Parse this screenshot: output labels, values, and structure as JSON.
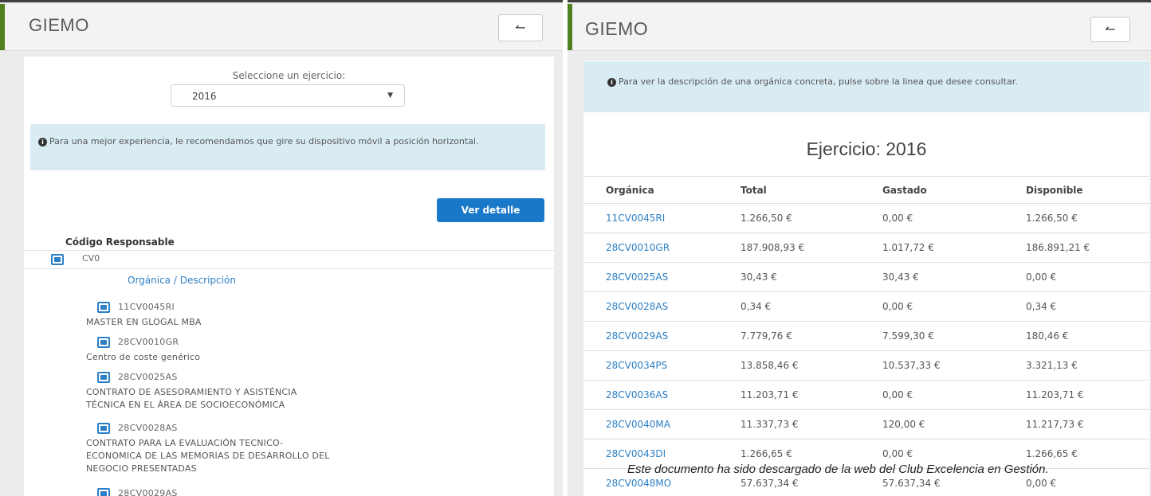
{
  "left": {
    "app_title": "GIEMO",
    "back_button": "↼",
    "select_label": "Seleccione un ejercicio:",
    "selected_year": "2016",
    "info_message": "Para una mejor experiencia, le recomendamos que gire su dispositivo móvil a posición horizontal.",
    "detail_button": "Ver detalle",
    "codigo_label": "Código Responsable",
    "responsible_code": "CV0",
    "organica_header": "Orgánica / Descripción",
    "tree": [
      {
        "code": "11CV0045RI",
        "desc": [
          "MASTER EN GLOGAL MBA"
        ]
      },
      {
        "code": "28CV0010GR",
        "desc": [
          "Centro de coste genérico"
        ]
      },
      {
        "code": "28CV0025AS",
        "desc": [
          "CONTRATO DE ASESORAMIENTO Y ASISTÉNCIA",
          "TÉCNICA EN EL ÁREA DE SOCIOECONÓMICA"
        ]
      },
      {
        "code": "28CV0028AS",
        "desc": [
          "CONTRATO PARA LA EVALUACIÓN TECNICO-",
          "ECONOMICA DE LAS MEMORIAS DE DESARROLLO DEL",
          "NEGOCIO PRESENTADAS"
        ]
      },
      {
        "code": "28CV0029AS",
        "desc": []
      }
    ]
  },
  "right": {
    "app_title": "GIEMO",
    "back_button": "↼",
    "info_message": "Para ver la descripción de una orgánica concreta, pulse sobre la linea que desee consultar.",
    "ejercicio_title": "Ejercicio: 2016",
    "columns": [
      "Orgánica",
      "Total",
      "Gastado",
      "Disponible"
    ],
    "rows": [
      [
        "11CV0045RI",
        "1.266,50 €",
        "0,00 €",
        "1.266,50 €"
      ],
      [
        "28CV0010GR",
        "187.908,93 €",
        "1.017,72 €",
        "186.891,21 €"
      ],
      [
        "28CV0025AS",
        "30,43 €",
        "30,43 €",
        "0,00 €"
      ],
      [
        "28CV0028AS",
        "0,34 €",
        "0,00 €",
        "0,34 €"
      ],
      [
        "28CV0029AS",
        "7.779,76 €",
        "7.599,30 €",
        "180,46 €"
      ],
      [
        "28CV0034PS",
        "13.858,46 €",
        "10.537,33 €",
        "3.321,13 €"
      ],
      [
        "28CV0036AS",
        "11.203,71 €",
        "0,00 €",
        "11.203,71 €"
      ],
      [
        "28CV0040MA",
        "11.337,73 €",
        "120,00 €",
        "11.217,73 €"
      ],
      [
        "28CV0043DI",
        "1.266,65 €",
        "0,00 €",
        "1.266,65 €"
      ],
      [
        "28CV0048MO",
        "57.637,34 €",
        "57.637,34 €",
        "0,00 €"
      ]
    ]
  },
  "watermark": "Este documento ha sido descargado de la web del Club Excelencia en Gestión."
}
